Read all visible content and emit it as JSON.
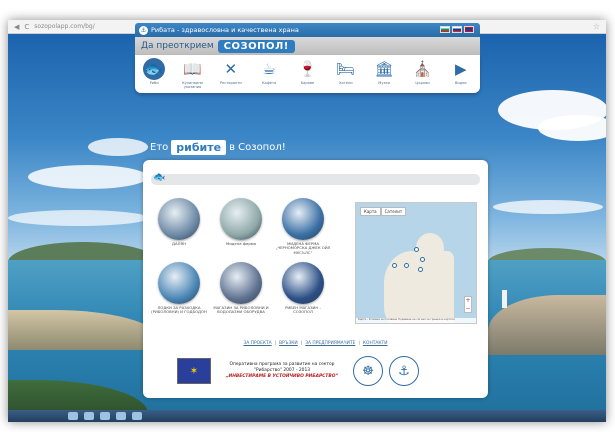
{
  "browser": {
    "url": "sozopolapp.com/bg/"
  },
  "site": {
    "header_title": "Рибата - здравословна и качествена храна",
    "slogan_prefix": "Да преоткрием",
    "slogan_highlight": "СОЗОПОЛ!",
    "languages": [
      "bg",
      "ru",
      "en"
    ],
    "menu": [
      {
        "label": "Риби",
        "icon": "fish-icon",
        "glyph": "🐟",
        "active": true
      },
      {
        "label": "Кулинарни указания",
        "icon": "book-icon",
        "glyph": "📖"
      },
      {
        "label": "Ресторанти",
        "icon": "cutlery-icon",
        "glyph": "✕"
      },
      {
        "label": "Кафета",
        "icon": "coffee-icon",
        "glyph": "☕"
      },
      {
        "label": "Барове",
        "icon": "wine-glass-icon",
        "glyph": "🍷"
      },
      {
        "label": "Хотели",
        "icon": "bed-icon",
        "glyph": "🛏"
      },
      {
        "label": "Музеи",
        "icon": "museum-icon",
        "glyph": "🏛"
      },
      {
        "label": "Църкви",
        "icon": "church-icon",
        "glyph": "⛪"
      },
      {
        "label": "Видео",
        "icon": "video-icon",
        "glyph": "▶"
      }
    ],
    "headline": {
      "prefix": "Ето",
      "highlight": "рибите",
      "suffix": "в Созопол!"
    },
    "categories": [
      {
        "caption": "ДАЛЯН",
        "color": "#6d8aa6"
      },
      {
        "caption": "Мидена ферма",
        "color": "#8fa9a8"
      },
      {
        "caption": "МИДЕНА ФЕРМА „ЧЕРНОМОРСКА ДЖЕК ОЙЛ МУСЪЛС“",
        "color": "#3a70a5"
      },
      {
        "caption": "ЛОДКИ ЗА РАЗХОДКА (РИБОЛОВНИ) И ГОДБОДОН",
        "color": "#4a86b5"
      },
      {
        "caption": "МАГАЗИН ЗА РИБОЛОВНИ И ВОДОЛАЗНИ ОБОРУДВА",
        "color": "#5f7290"
      },
      {
        "caption": "РИБЕН МАГАЗИН - СОЗОПОЛ",
        "color": "#2c4f86"
      }
    ],
    "map": {
      "tab_map": "Карта",
      "tab_satellite": "Сателит",
      "footer": "Карти - Условия за ползване  Подаване на сигнал за грешка в картата"
    },
    "footer_links": [
      "ЗА ПРОЕКТА",
      "ВРЪЗКИ",
      "ЗА ПРЕДПРИЯМАЧИТЕ",
      "КОНТАКТИ"
    ],
    "eu": {
      "line1": "Оперативна програма за развитие на сектор",
      "line2": "\"Рибарство\" 2007 - 2013",
      "line3": "„ИНВЕСТИРАМЕ В УСТОЙЧИВО РИБАРСТВО“"
    }
  }
}
